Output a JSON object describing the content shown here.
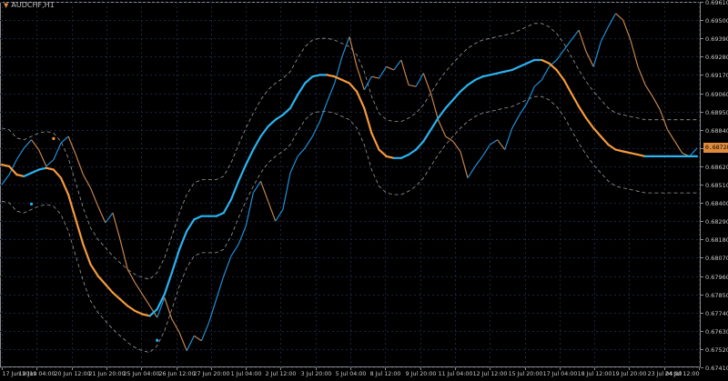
{
  "window": {
    "symbol_label": "AUDCHF,H1",
    "current_price": "0.68728"
  },
  "colors": {
    "background": "#000000",
    "grid": "#1b2440",
    "axis": "#8a8a8a",
    "rising": "#1f8fd6",
    "falling": "#c4834a",
    "ma_up": "#2ab3f0",
    "ma_down": "#f59a3c",
    "band": "#9a9a9a",
    "dot_up": "#2ab3f0",
    "dot_down": "#f59a3c",
    "tag": "#e08a3c"
  },
  "chart_data": {
    "type": "line",
    "title": "AUDCHF,H1",
    "xlabel": "",
    "ylabel": "",
    "ylim": [
      0.6741,
      0.6961
    ],
    "y_ticks": [
      0.6961,
      0.695,
      0.6939,
      0.6928,
      0.6917,
      0.6906,
      0.6895,
      0.6884,
      0.6873,
      0.6862,
      0.6851,
      0.684,
      0.6829,
      0.6818,
      0.6807,
      0.6796,
      0.6785,
      0.6774,
      0.6763,
      0.6752,
      0.6741
    ],
    "y_tick_labels": [
      "0.69610",
      "0.69500",
      "0.69390",
      "0.69280",
      "0.69170",
      "0.69060",
      "0.68950",
      "0.68840",
      "0.68730",
      "0.68620",
      "0.68510",
      "0.68400",
      "0.68290",
      "0.68180",
      "0.68070",
      "0.67960",
      "0.67850",
      "0.67740",
      "0.67630",
      "0.67520",
      "0.67410"
    ],
    "x_ticks": [
      "17 Jun 2019",
      "19 Jun 04:00",
      "20 Jun 12:00",
      "21 Jun 20:00",
      "25 Jun 04:00",
      "26 Jun 12:00",
      "27 Jun 20:00",
      "1 Jul 04:00",
      "2 Jul 12:00",
      "3 Jul 20:00",
      "5 Jul 04:00",
      "8 Jul 12:00",
      "9 Jul 20:00",
      "11 Jul 04:00",
      "12 Jul 12:00",
      "15 Jul 20:00",
      "17 Jul 04:00",
      "18 Jul 12:00",
      "19 Jul 20:00",
      "23 Jul 04:00",
      "24 Jul 12:00"
    ],
    "series": [
      {
        "name": "Price",
        "values": [
          0.6851,
          0.6857,
          0.6866,
          0.6873,
          0.6878,
          0.6872,
          0.6862,
          0.6866,
          0.6876,
          0.688,
          0.6869,
          0.6857,
          0.6849,
          0.6838,
          0.6828,
          0.6834,
          0.6818,
          0.68,
          0.6792,
          0.6785,
          0.6778,
          0.6771,
          0.6783,
          0.677,
          0.6762,
          0.6751,
          0.676,
          0.6757,
          0.6768,
          0.6782,
          0.6796,
          0.6808,
          0.6815,
          0.6826,
          0.6846,
          0.6853,
          0.6841,
          0.6829,
          0.6836,
          0.6858,
          0.6868,
          0.6873,
          0.688,
          0.6889,
          0.6901,
          0.6912,
          0.6928,
          0.694,
          0.6922,
          0.6908,
          0.6916,
          0.6915,
          0.6922,
          0.692,
          0.6926,
          0.6911,
          0.691,
          0.6918,
          0.6906,
          0.689,
          0.688,
          0.6877,
          0.6871,
          0.6855,
          0.6862,
          0.6868,
          0.6875,
          0.6878,
          0.6872,
          0.6885,
          0.6893,
          0.69,
          0.691,
          0.6914,
          0.6922,
          0.6926,
          0.6932,
          0.6938,
          0.6944,
          0.6931,
          0.6922,
          0.6937,
          0.6946,
          0.6954,
          0.695,
          0.6938,
          0.6922,
          0.6911,
          0.6904,
          0.6896,
          0.6884,
          0.6877,
          0.687,
          0.6868,
          0.6873
        ]
      },
      {
        "name": "MA",
        "values": [
          0.6863,
          0.6862,
          0.6857,
          0.6856,
          0.6858,
          0.686,
          0.6861,
          0.686,
          0.6855,
          0.6845,
          0.683,
          0.6815,
          0.6803,
          0.6796,
          0.6791,
          0.6786,
          0.6782,
          0.6778,
          0.6775,
          0.6773,
          0.6772,
          0.6776,
          0.6785,
          0.6798,
          0.6812,
          0.6823,
          0.683,
          0.6832,
          0.6832,
          0.6832,
          0.6834,
          0.6842,
          0.6853,
          0.6863,
          0.6872,
          0.688,
          0.6886,
          0.689,
          0.6893,
          0.6897,
          0.6905,
          0.6912,
          0.6916,
          0.6917,
          0.6917,
          0.6916,
          0.6914,
          0.6912,
          0.6907,
          0.6897,
          0.6882,
          0.6872,
          0.6868,
          0.6867,
          0.6867,
          0.6869,
          0.6872,
          0.6877,
          0.6884,
          0.6891,
          0.6897,
          0.6902,
          0.6907,
          0.6911,
          0.6914,
          0.6916,
          0.6917,
          0.6918,
          0.6919,
          0.692,
          0.6922,
          0.6924,
          0.6926,
          0.6926,
          0.6924,
          0.692,
          0.6914,
          0.6906,
          0.6898,
          0.6891,
          0.6885,
          0.688,
          0.6875,
          0.6872,
          0.6871,
          0.687,
          0.6869,
          0.6868,
          0.6868,
          0.6868,
          0.6868,
          0.6868,
          0.6868,
          0.6868,
          0.6868
        ]
      }
    ],
    "grid": true,
    "legend": "none"
  }
}
